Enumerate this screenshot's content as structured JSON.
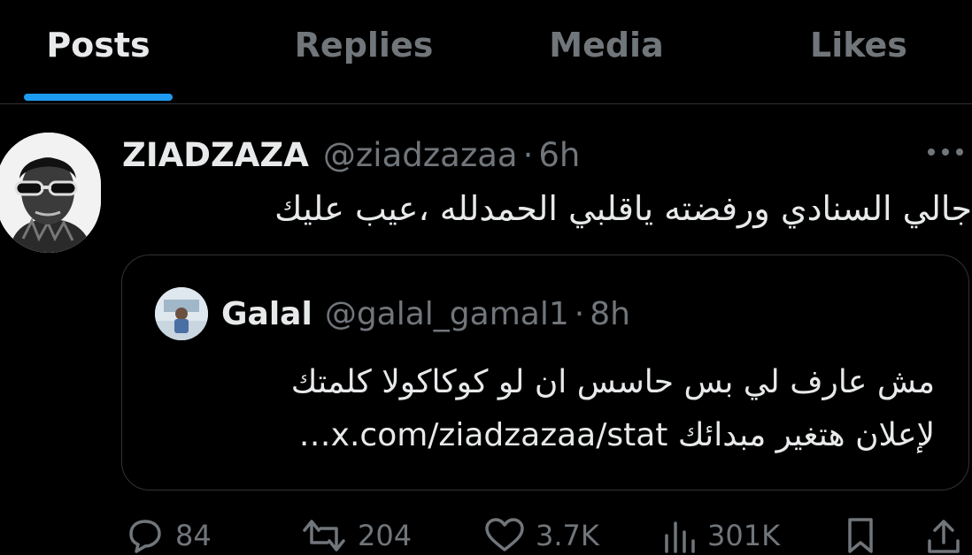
{
  "tabs": [
    {
      "label": "Posts",
      "active": true
    },
    {
      "label": "Replies",
      "active": false
    },
    {
      "label": "Media",
      "active": false
    },
    {
      "label": "Likes",
      "active": false
    }
  ],
  "tweet": {
    "author_name": "ZIADZAZA",
    "author_handle": "@ziadzazaa",
    "separator": "·",
    "time": "6h",
    "more_icon": "ellipsis-icon",
    "text": "جالي السنادي ورفضته ياقلبي الحمدلله ،عيب عليك"
  },
  "quote": {
    "author_name": "Galal",
    "author_handle": "@galal_gamal1",
    "separator": "·",
    "time": "8h",
    "line1": "مش عارف لي بس حاسس ان لو كوكاكولا كلمتك",
    "line2": "لإعلان هتغير مبدائك x.com/ziadzazaa/stat…"
  },
  "actions": {
    "replies": "84",
    "reposts": "204",
    "likes": "3.7K",
    "views": "301K"
  },
  "colors": {
    "background": "#000000",
    "text": "#e7e9ea",
    "muted": "#71767b",
    "accent": "#1d9bf0",
    "border": "#2f3336"
  }
}
